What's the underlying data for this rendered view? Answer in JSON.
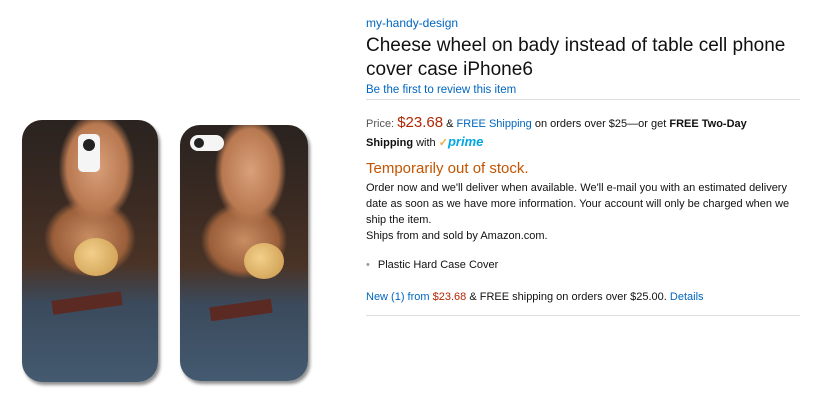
{
  "brand": "my-handy-design",
  "title": "Cheese wheel on bady instead of table cell phone cover case iPhone6",
  "review_link": "Be the first to review this item",
  "price": {
    "label": "Price:",
    "amount": "$23.68",
    "amp": "&",
    "free_shipping_link": "FREE Shipping",
    "mid_text": "on orders over $25—or get",
    "two_day": "FREE Two-Day Shipping",
    "with": "with",
    "prime_check": "✓",
    "prime_word": "prime"
  },
  "stock": {
    "status": "Temporarily out of stock.",
    "description": "Order now and we'll deliver when available. We'll e-mail you with an estimated delivery date as soon as we have more information. Your account will only be charged when we ship the item.",
    "ships_from": "Ships from and sold by Amazon.com."
  },
  "features": [
    "Plastic Hard Case Cover"
  ],
  "offers": {
    "new_link": "New (1) from",
    "new_price": "$23.68",
    "shipping_text": "& FREE shipping on orders over $25.00.",
    "details_link": "Details"
  },
  "colors": {
    "link": "#0066c0",
    "price": "#B12704",
    "out_of_stock": "#c45500",
    "prime": "#00a8e1"
  }
}
